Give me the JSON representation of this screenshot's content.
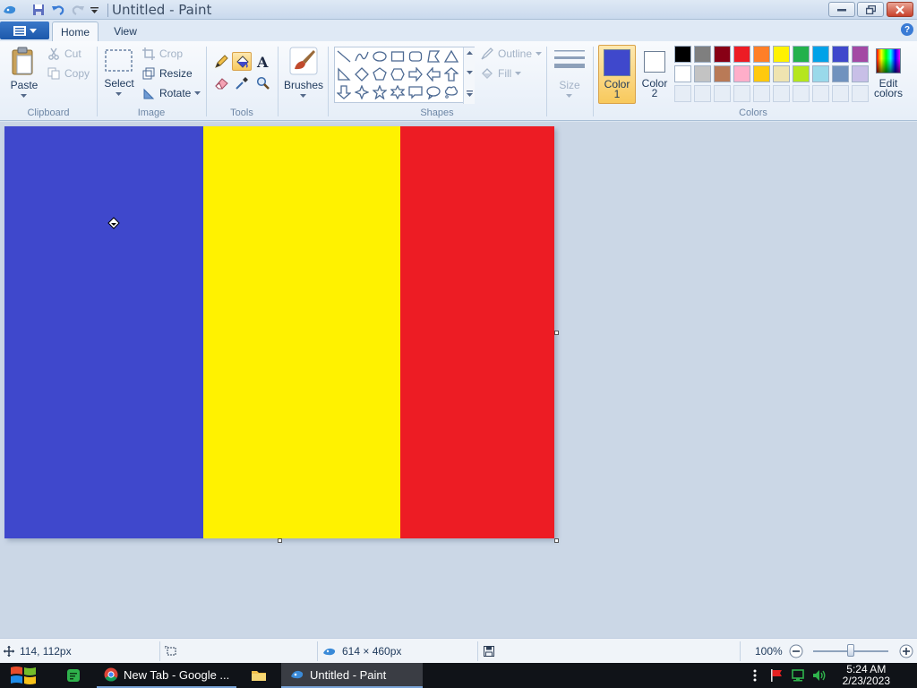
{
  "window": {
    "title": "Untitled - Paint"
  },
  "tabs": {
    "home": "Home",
    "view": "View"
  },
  "clipboard": {
    "paste": "Paste",
    "cut": "Cut",
    "copy": "Copy",
    "group": "Clipboard"
  },
  "image": {
    "select": "Select",
    "crop": "Crop",
    "resize": "Resize",
    "rotate": "Rotate",
    "group": "Image"
  },
  "tools": {
    "group": "Tools"
  },
  "brushes": {
    "label": "Brushes"
  },
  "shapes": {
    "outline": "Outline",
    "fill": "Fill",
    "group": "Shapes"
  },
  "size": {
    "label": "Size"
  },
  "colors": {
    "color1_line1": "Color",
    "color1_line2": "1",
    "color2_line1": "Color",
    "color2_line2": "2",
    "edit_line1": "Edit",
    "edit_line2": "colors",
    "group": "Colors",
    "color1_value": "#3f48cc",
    "color2_value": "#ffffff",
    "palette_row1": [
      "#000000",
      "#7f7f7f",
      "#880015",
      "#ed1c24",
      "#ff7f27",
      "#fff200",
      "#22b14c",
      "#00a2e8",
      "#3f48cc",
      "#a349a4"
    ],
    "palette_row2": [
      "#ffffff",
      "#c3c3c3",
      "#b97a57",
      "#ffaec9",
      "#ffc90e",
      "#efe4b0",
      "#b5e61d",
      "#99d9ea",
      "#7092be",
      "#c8bfe7"
    ]
  },
  "canvas": {
    "stripes": [
      "#3f48cc",
      "#fff200",
      "#ed1c24"
    ]
  },
  "statusbar": {
    "cursor_pos": "114, 112px",
    "canvas_size": "614 × 460px",
    "zoom": "100%"
  },
  "taskbar": {
    "chrome_label": "New Tab - Google ...",
    "paint_label": "Untitled - Paint",
    "time": "5:24 AM",
    "date": "2/23/2023"
  }
}
